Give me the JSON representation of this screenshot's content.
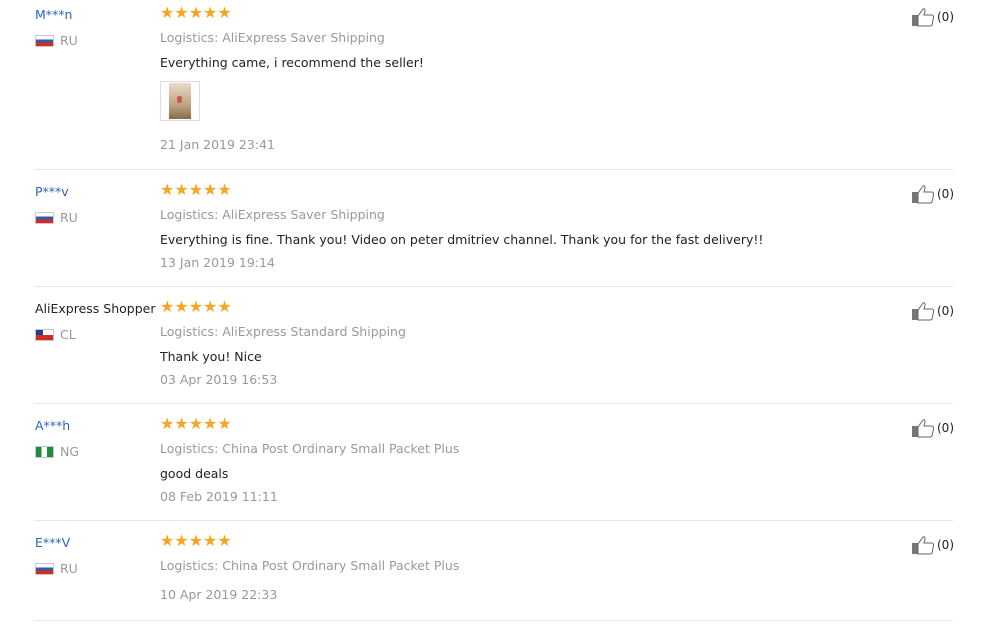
{
  "star_glyphs": "★★★★★",
  "reviews": [
    {
      "user": "M***n",
      "country": "RU",
      "logistics": "Logistics: AliExpress Saver Shipping",
      "text": "Everything came, i recommend the seller!",
      "date": "21 Jan 2019 23:41",
      "helpful": "(0)",
      "rating": 5,
      "has_photo": true
    },
    {
      "user": "P***v",
      "country": "RU",
      "logistics": "Logistics: AliExpress Saver Shipping",
      "text": "Everything is fine. Thank you! Video on peter dmitriev channel. Thank you for the fast delivery!!",
      "date": "13 Jan 2019 19:14",
      "helpful": "(0)",
      "rating": 5
    },
    {
      "user": "AliExpress Shopper",
      "country": "CL",
      "logistics": "Logistics: AliExpress Standard Shipping",
      "text": "Thank you! Nice",
      "date": "03 Apr 2019 16:53",
      "helpful": "(0)",
      "rating": 5
    },
    {
      "user": "A***h",
      "country": "NG",
      "logistics": "Logistics: China Post Ordinary Small Packet Plus",
      "text": "good deals",
      "date": "08 Feb 2019 11:11",
      "helpful": "(0)",
      "rating": 5
    },
    {
      "user": "E***V",
      "country": "RU",
      "logistics": "Logistics: China Post Ordinary Small Packet Plus",
      "text": "",
      "date": "10 Apr 2019 22:33",
      "helpful": "(0)",
      "rating": 5
    }
  ],
  "colors": {
    "star": "#f5a623",
    "username_link": "#2e64c0",
    "muted": "#999999",
    "divider": "#e8e8e8"
  },
  "icons": {
    "helpful": "thumbs-up-icon",
    "flag_ru": "russia-flag-icon",
    "flag_cl": "chile-flag-icon",
    "flag_ng": "nigeria-flag-icon"
  }
}
